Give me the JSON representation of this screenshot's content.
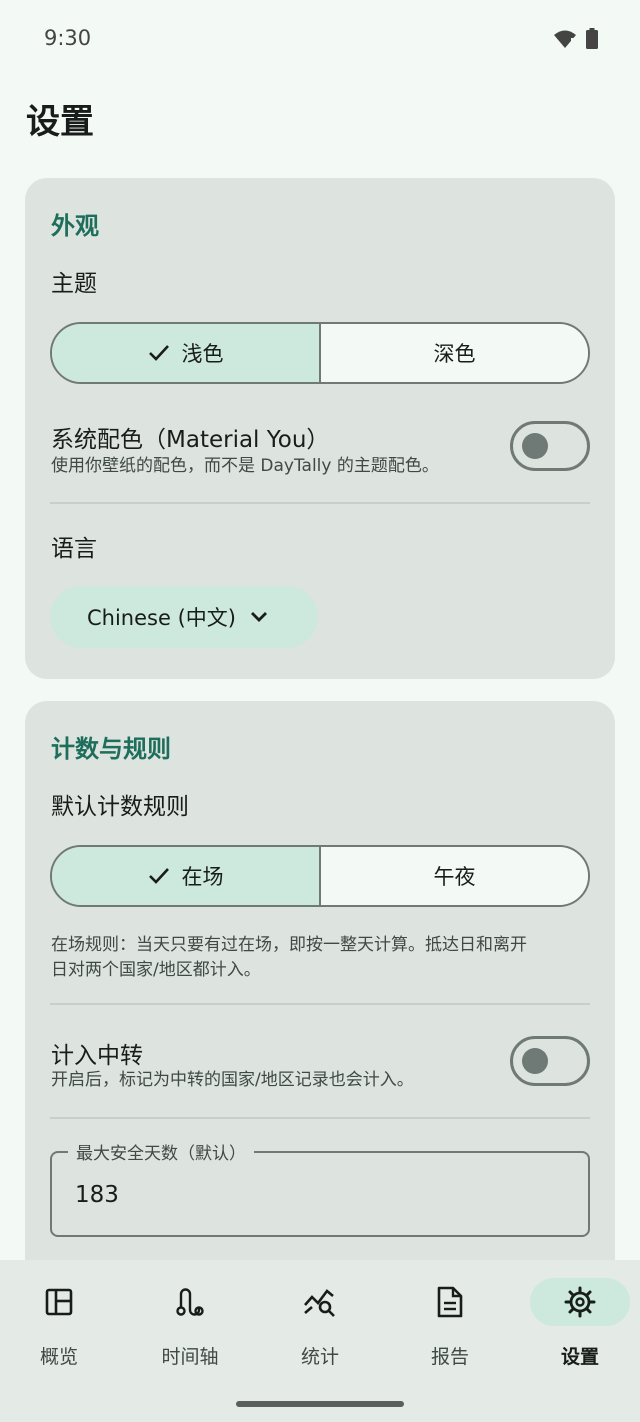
{
  "status_bar": {
    "time": "9:30"
  },
  "page": {
    "title": "设置"
  },
  "appearance": {
    "section_title": "外观",
    "theme_label": "主题",
    "theme_options": [
      "浅色",
      "深色"
    ],
    "theme_selected": 0,
    "material_you_title": "系统配色（Material You）",
    "material_you_desc": "使用你壁纸的配色，而不是 DayTally 的主题配色。",
    "material_you_on": false,
    "language_label": "语言",
    "language_value": "Chinese (中文)"
  },
  "counting": {
    "section_title": "计数与规则",
    "rule_label": "默认计数规则",
    "rule_options": [
      "在场",
      "午夜"
    ],
    "rule_selected": 0,
    "rule_desc_line1": "在场规则：当天只要有过在场，即按一整天计算。抵达日和离开",
    "rule_desc_line2": "日对两个国家/地区都计入。",
    "transit_title": "计入中转",
    "transit_desc": "开启后，标记为中转的国家/地区记录也会计入。",
    "transit_on": false,
    "max_safe_days_label": "最大安全天数（默认）",
    "max_safe_days_value": "183"
  },
  "nav": {
    "items": [
      {
        "label": "概览",
        "icon": "dashboard-icon"
      },
      {
        "label": "时间轴",
        "icon": "timeline-icon"
      },
      {
        "label": "统计",
        "icon": "stats-icon"
      },
      {
        "label": "报告",
        "icon": "report-icon"
      },
      {
        "label": "设置",
        "icon": "gear-icon"
      }
    ],
    "active": 4
  },
  "colors": {
    "accent": "#1e6e5c",
    "selected_bg": "#cde8dd",
    "card_bg": "#dde3df",
    "page_bg": "#f3f9f5"
  }
}
